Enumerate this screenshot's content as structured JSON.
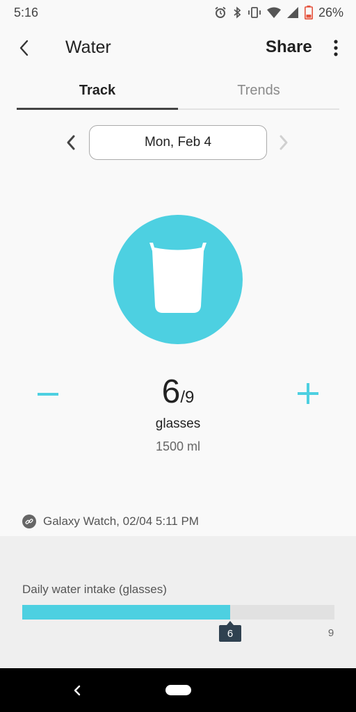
{
  "status_bar": {
    "time": "5:16",
    "battery": "26%",
    "icons": [
      "alarm-icon",
      "bluetooth-icon",
      "vibrate-icon",
      "wifi-icon",
      "signal-icon",
      "battery-icon"
    ]
  },
  "header": {
    "title": "Water",
    "share_label": "Share",
    "back_icon": "back-arrow-icon",
    "more_icon": "more-vert-icon"
  },
  "tabs": [
    {
      "label": "Track",
      "selected": true
    },
    {
      "label": "Trends",
      "selected": false
    }
  ],
  "date_selector": {
    "label": "Mon, Feb 4",
    "prev_icon": "chevron-left-icon",
    "next_icon": "chevron-right-icon",
    "next_enabled": false
  },
  "counter": {
    "value": "6",
    "goal": "/9",
    "unit": "glasses",
    "volume": "1500 ml",
    "minus_icon": "minus-icon",
    "plus_icon": "plus-icon"
  },
  "source": {
    "text": "Galaxy Watch, 02/04 5:11 PM",
    "icon": "link-icon"
  },
  "intake": {
    "title": "Daily water intake (glasses)",
    "current": 6,
    "current_label": "6",
    "max": 9,
    "max_label": "9"
  },
  "colors": {
    "accent": "#4dd0e1",
    "marker": "#2f4150",
    "background": "#f9f9f9",
    "panel": "#efefef"
  },
  "nav_bar": {
    "icons": [
      "nav-back-icon",
      "nav-home-pill"
    ]
  }
}
